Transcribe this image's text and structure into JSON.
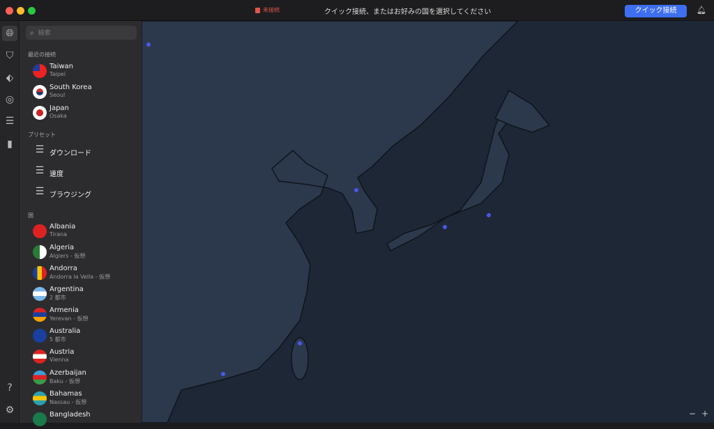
{
  "titlebar": {
    "status": "未接続",
    "title": "クイック接続、またはお好みの国を選択してください",
    "quick_connect": "クイック接続"
  },
  "rail": {
    "icons": [
      "globe-icon",
      "shield-bolt-icon",
      "meshnet-icon",
      "radar-icon",
      "layers-icon",
      "stats-icon",
      "help-icon",
      "settings-icon"
    ]
  },
  "sidebar": {
    "search_placeholder": "検索",
    "recent_title": "最近の接続",
    "recent": [
      {
        "name": "Taiwan",
        "sub": "Taipei"
      },
      {
        "name": "South Korea",
        "sub": "Seoul"
      },
      {
        "name": "Japan",
        "sub": "Osaka"
      }
    ],
    "presets_title": "プリセット",
    "presets": [
      {
        "name": "ダウンロード"
      },
      {
        "name": "速度"
      },
      {
        "name": "ブラウジング"
      }
    ],
    "countries_title": "国",
    "countries": [
      {
        "name": "Albania",
        "sub": "Tirana"
      },
      {
        "name": "Algeria",
        "sub": "Algiers - 仮想"
      },
      {
        "name": "Andorra",
        "sub": "Andorra la Vella - 仮想"
      },
      {
        "name": "Argentina",
        "sub": "2 都市"
      },
      {
        "name": "Armenia",
        "sub": "Yerevan - 仮想"
      },
      {
        "name": "Australia",
        "sub": "5 都市"
      },
      {
        "name": "Austria",
        "sub": "Vienna"
      },
      {
        "name": "Azerbaijan",
        "sub": "Baku - 仮想"
      },
      {
        "name": "Bahamas",
        "sub": "Nassau - 仮想"
      },
      {
        "name": "Bangladesh",
        "sub": ""
      }
    ]
  },
  "map": {
    "zoom_out": "−",
    "zoom_in": "+",
    "land_color": "#2c394c",
    "sea_color": "#1e2735",
    "accent": "#3e6ff0"
  }
}
